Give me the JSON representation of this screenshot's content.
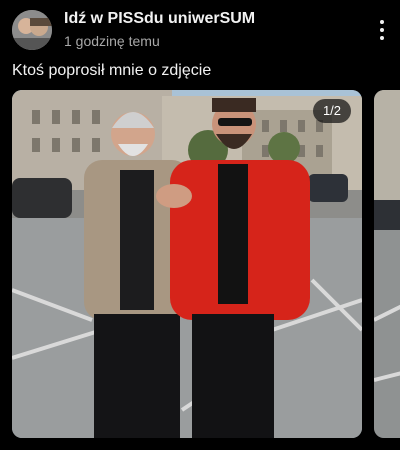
{
  "post": {
    "channel_name": "Idź w PISSdu uniwerSUM",
    "time_ago": "1 godzinę temu",
    "text": "Ktoś poprosił mnie o zdjęcie"
  },
  "carousel": {
    "counter": "1/2"
  },
  "icons": {
    "more": "more-vertical-icon"
  },
  "colors": {
    "background": "#000000",
    "primary_text": "#f2f2f2",
    "secondary_text": "#a8a8a8",
    "badge_bg": "#141414"
  }
}
